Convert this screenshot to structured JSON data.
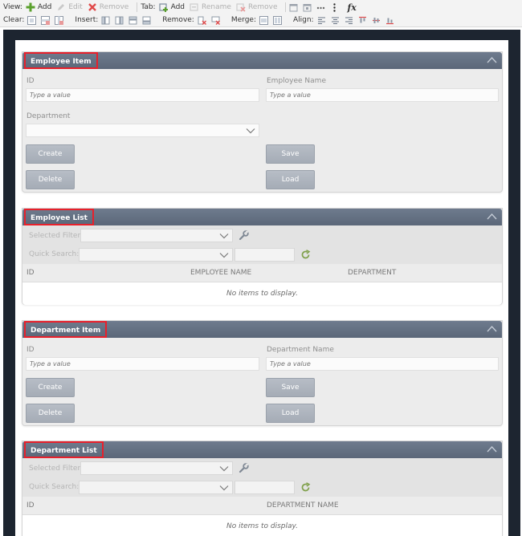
{
  "toolbar": {
    "row1": {
      "view_label": "View:",
      "add": "Add",
      "edit": "Edit",
      "remove": "Remove",
      "tab_label": "Tab:",
      "tab_add": "Add",
      "tab_rename": "Rename",
      "tab_remove": "Remove"
    },
    "row2": {
      "clear_label": "Clear:",
      "insert_label": "Insert:",
      "remove_label": "Remove:",
      "merge_label": "Merge:",
      "align_label": "Align:"
    },
    "formula_glyph": "fx"
  },
  "panels": {
    "employee_item": {
      "title": "Employee Item",
      "id_label": "ID",
      "id_placeholder": "Type a value",
      "name_label": "Employee Name",
      "name_placeholder": "Type a value",
      "department_label": "Department",
      "buttons": {
        "create": "Create",
        "save": "Save",
        "delete": "Delete",
        "load": "Load"
      }
    },
    "employee_list": {
      "title": "Employee List",
      "selected_filter_label": "Selected Filter:",
      "quick_search_label": "Quick Search:",
      "columns": [
        "ID",
        "EMPLOYEE NAME",
        "DEPARTMENT"
      ],
      "empty_text": "No items to display."
    },
    "department_item": {
      "title": "Department Item",
      "id_label": "ID",
      "id_placeholder": "Type a value",
      "name_label": "Department Name",
      "name_placeholder": "Type a value",
      "buttons": {
        "create": "Create",
        "save": "Save",
        "delete": "Delete",
        "load": "Load"
      }
    },
    "department_list": {
      "title": "Department List",
      "selected_filter_label": "Selected Filter:",
      "quick_search_label": "Quick Search:",
      "columns": [
        "ID",
        "DEPARTMENT NAME"
      ],
      "empty_text": "No items to display."
    }
  },
  "colors": {
    "panel_header": "#616d80",
    "highlight_border": "#e8202b",
    "button": "#aab0ba",
    "frame": "#1d2530"
  }
}
